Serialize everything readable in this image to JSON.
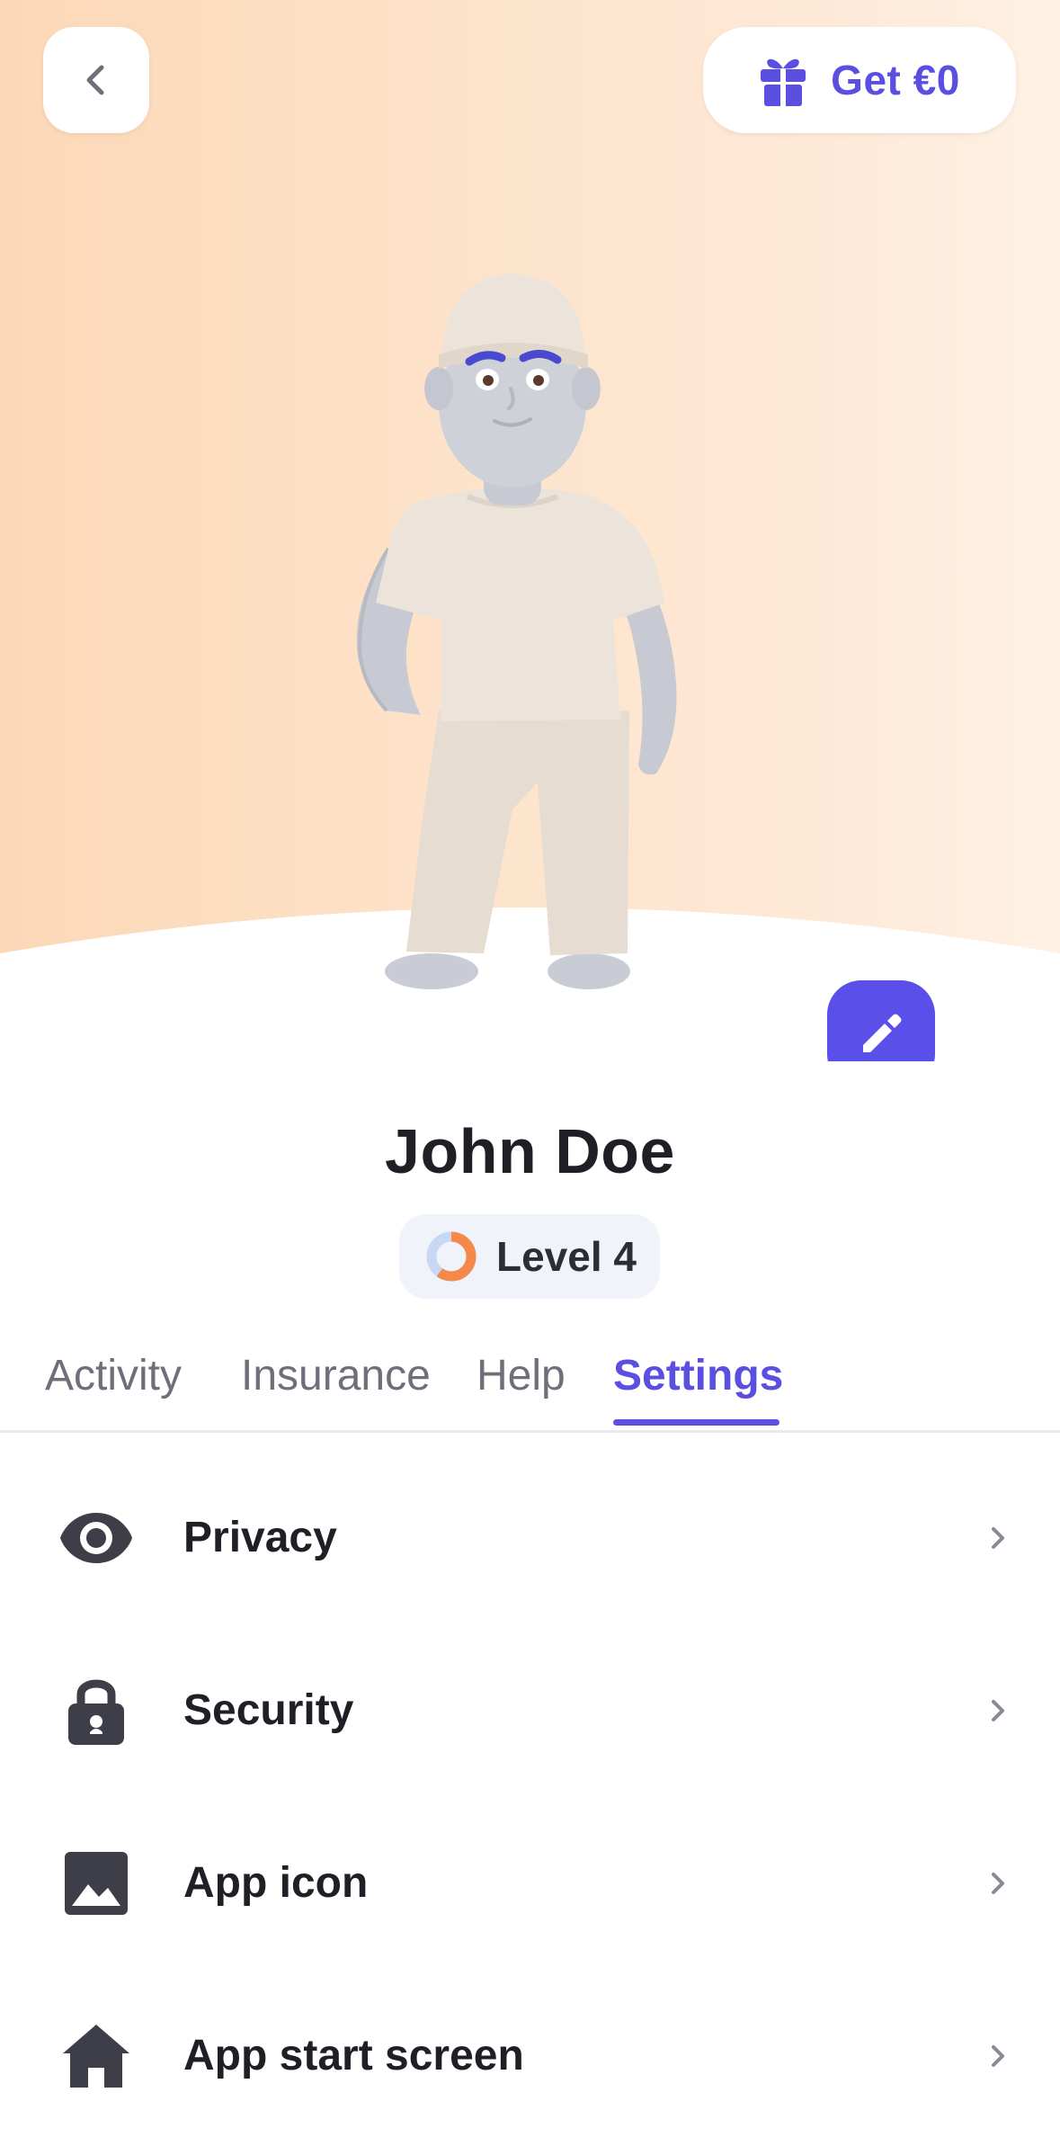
{
  "header": {
    "back_icon": "chevron-left-icon",
    "referral": {
      "icon": "gift-icon",
      "label": "Get €0"
    }
  },
  "profile": {
    "name": "John Doe",
    "level_label": "Level 4",
    "level_progress": 0.6,
    "edit_icon": "pencil-icon"
  },
  "tabs": [
    {
      "label": "Activity",
      "active": false
    },
    {
      "label": "Insurance",
      "active": false
    },
    {
      "label": "Help",
      "active": false
    },
    {
      "label": "Settings",
      "active": true
    }
  ],
  "settings": [
    {
      "label": "Privacy",
      "icon": "eye-icon"
    },
    {
      "label": "Security",
      "icon": "lock-icon"
    },
    {
      "label": "App icon",
      "icon": "image-icon"
    },
    {
      "label": "App start screen",
      "icon": "home-icon"
    }
  ],
  "colors": {
    "accent": "#5a4fe0",
    "hero_gradient_start": "#fcd8b7",
    "hero_gradient_end": "#fef1e4",
    "level_ring": "#f5894a"
  }
}
